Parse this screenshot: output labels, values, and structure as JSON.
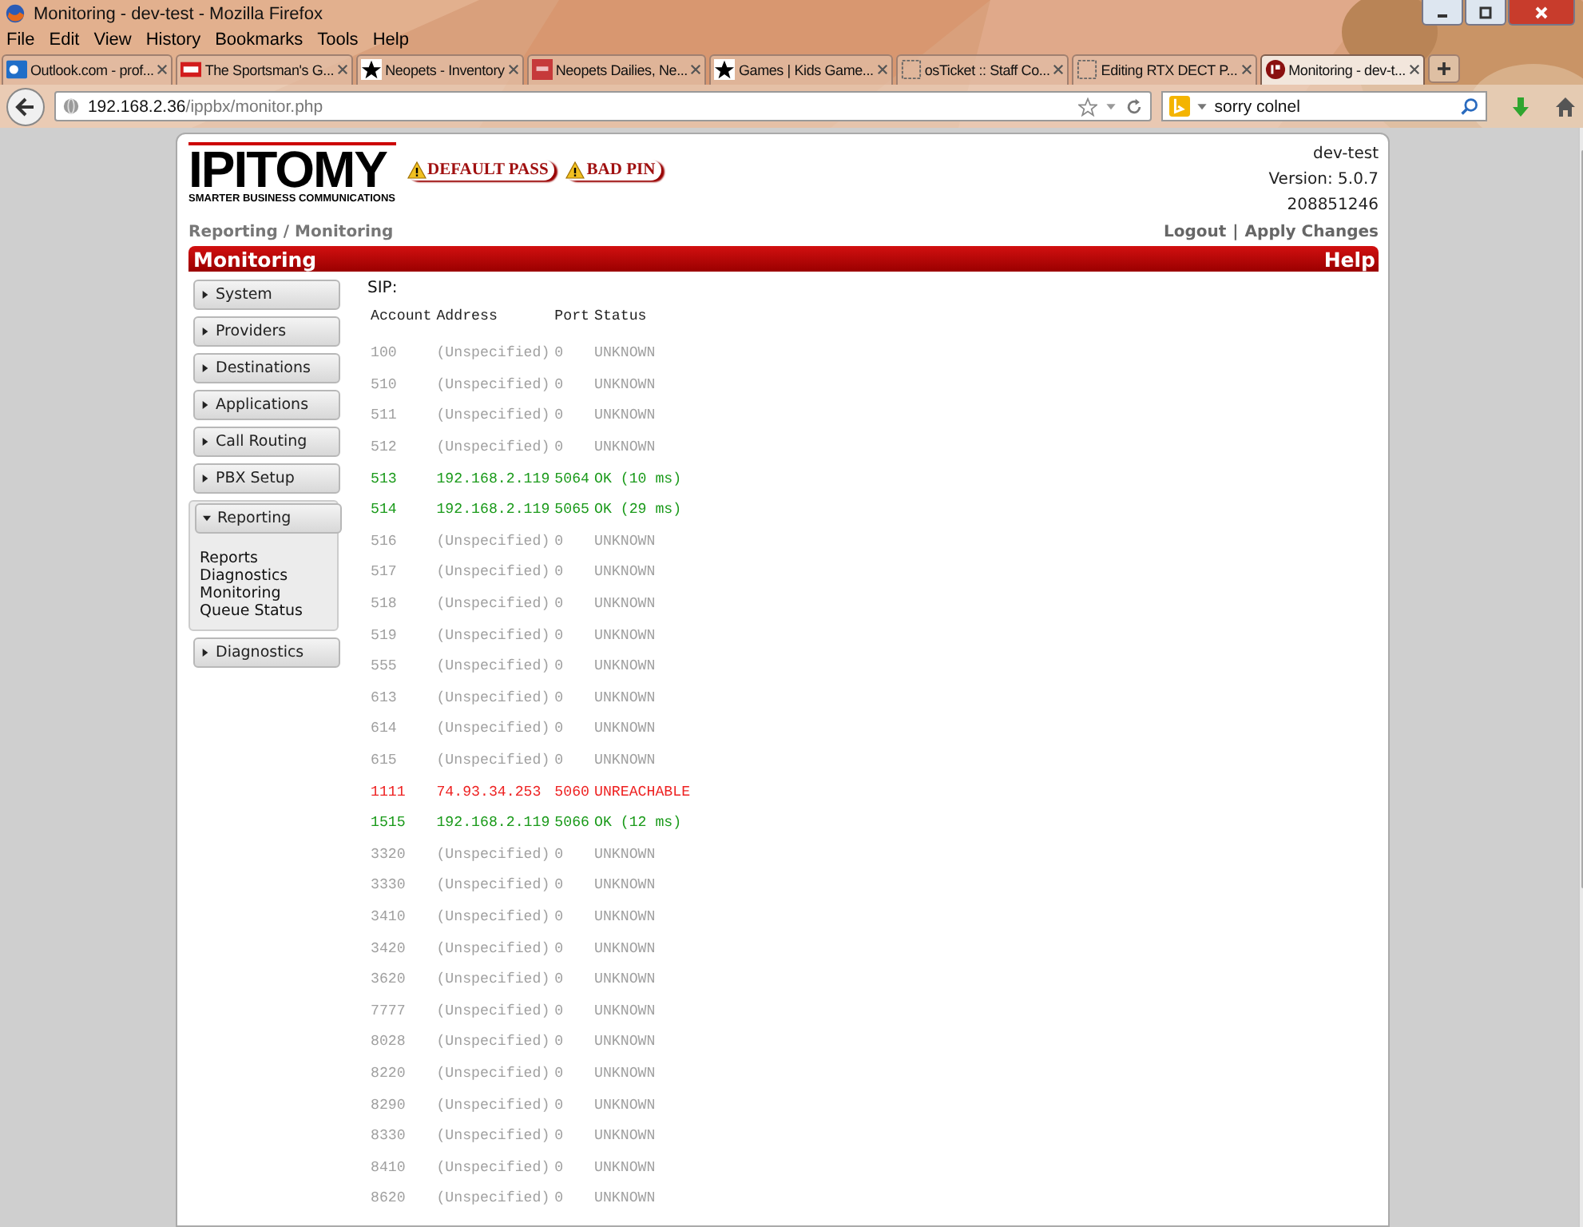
{
  "window": {
    "title": "Monitoring - dev-test - Mozilla Firefox"
  },
  "menu": [
    "File",
    "Edit",
    "View",
    "History",
    "Bookmarks",
    "Tools",
    "Help"
  ],
  "tabs": [
    {
      "label": "Outlook.com - prof...",
      "kind": "mail",
      "selected": false
    },
    {
      "label": "The Sportsman's G...",
      "kind": "store",
      "selected": false
    },
    {
      "label": "Neopets - Inventory",
      "kind": "star",
      "selected": false
    },
    {
      "label": "Neopets Dailies, Ne...",
      "kind": "badge",
      "selected": false
    },
    {
      "label": "Games | Kids Game...",
      "kind": "star",
      "selected": false
    },
    {
      "label": "osTicket :: Staff Co...",
      "kind": "page",
      "selected": false
    },
    {
      "label": "Editing RTX DECT P...",
      "kind": "page",
      "selected": false
    },
    {
      "label": "Monitoring - dev-t...",
      "kind": "logo",
      "selected": true
    }
  ],
  "address": {
    "host": "192.168.2.36",
    "path": "/ippbx/monitor.php"
  },
  "search": {
    "value": "sorry colnel"
  },
  "header": {
    "logo": "IPITOMY",
    "tagline": "SMARTER BUSINESS COMMUNICATIONS",
    "warnings": [
      "DEFAULT PASS",
      "BAD PIN"
    ],
    "hostname": "dev-test",
    "version": "Version: 5.0.7",
    "serial": "208851246",
    "breadcrumb": "Reporting / Monitoring",
    "links": [
      "Logout",
      "Apply Changes"
    ],
    "separator": "|"
  },
  "title_bar": {
    "title": "Monitoring",
    "help": "Help"
  },
  "sidebar": [
    {
      "label": "System",
      "expanded": false
    },
    {
      "label": "Providers",
      "expanded": false
    },
    {
      "label": "Destinations",
      "expanded": false
    },
    {
      "label": "Applications",
      "expanded": false
    },
    {
      "label": "Call Routing",
      "expanded": false
    },
    {
      "label": "PBX Setup",
      "expanded": false
    },
    {
      "label": "Reporting",
      "expanded": true,
      "children": [
        "Reports",
        "Diagnostics",
        "Monitoring",
        "Queue Status"
      ]
    },
    {
      "label": "Diagnostics",
      "expanded": false
    }
  ],
  "section": "SIP:",
  "table": {
    "columns": [
      "Account",
      "Address",
      "Port",
      "Status"
    ],
    "rows": [
      {
        "kind": "unknown",
        "cells": [
          "100",
          "(Unspecified)",
          "0",
          "UNKNOWN"
        ]
      },
      {
        "kind": "unknown",
        "cells": [
          "510",
          "(Unspecified)",
          "0",
          "UNKNOWN"
        ]
      },
      {
        "kind": "unknown",
        "cells": [
          "511",
          "(Unspecified)",
          "0",
          "UNKNOWN"
        ]
      },
      {
        "kind": "unknown",
        "cells": [
          "512",
          "(Unspecified)",
          "0",
          "UNKNOWN"
        ]
      },
      {
        "kind": "ok",
        "cells": [
          "513",
          "192.168.2.119",
          "5064",
          "OK (10 ms)"
        ]
      },
      {
        "kind": "ok",
        "cells": [
          "514",
          "192.168.2.119",
          "5065",
          "OK (29 ms)"
        ]
      },
      {
        "kind": "unknown",
        "cells": [
          "516",
          "(Unspecified)",
          "0",
          "UNKNOWN"
        ]
      },
      {
        "kind": "unknown",
        "cells": [
          "517",
          "(Unspecified)",
          "0",
          "UNKNOWN"
        ]
      },
      {
        "kind": "unknown",
        "cells": [
          "518",
          "(Unspecified)",
          "0",
          "UNKNOWN"
        ]
      },
      {
        "kind": "unknown",
        "cells": [
          "519",
          "(Unspecified)",
          "0",
          "UNKNOWN"
        ]
      },
      {
        "kind": "unknown",
        "cells": [
          "555",
          "(Unspecified)",
          "0",
          "UNKNOWN"
        ]
      },
      {
        "kind": "unknown",
        "cells": [
          "613",
          "(Unspecified)",
          "0",
          "UNKNOWN"
        ]
      },
      {
        "kind": "unknown",
        "cells": [
          "614",
          "(Unspecified)",
          "0",
          "UNKNOWN"
        ]
      },
      {
        "kind": "unknown",
        "cells": [
          "615",
          "(Unspecified)",
          "0",
          "UNKNOWN"
        ]
      },
      {
        "kind": "unreachable",
        "cells": [
          "1111",
          "74.93.34.253",
          "5060",
          "UNREACHABLE"
        ]
      },
      {
        "kind": "ok",
        "cells": [
          "1515",
          "192.168.2.119",
          "5066",
          "OK (12 ms)"
        ]
      },
      {
        "kind": "unknown",
        "cells": [
          "3320",
          "(Unspecified)",
          "0",
          "UNKNOWN"
        ]
      },
      {
        "kind": "unknown",
        "cells": [
          "3330",
          "(Unspecified)",
          "0",
          "UNKNOWN"
        ]
      },
      {
        "kind": "unknown",
        "cells": [
          "3410",
          "(Unspecified)",
          "0",
          "UNKNOWN"
        ]
      },
      {
        "kind": "unknown",
        "cells": [
          "3420",
          "(Unspecified)",
          "0",
          "UNKNOWN"
        ]
      },
      {
        "kind": "unknown",
        "cells": [
          "3620",
          "(Unspecified)",
          "0",
          "UNKNOWN"
        ]
      },
      {
        "kind": "unknown",
        "cells": [
          "7777",
          "(Unspecified)",
          "0",
          "UNKNOWN"
        ]
      },
      {
        "kind": "unknown",
        "cells": [
          "8028",
          "(Unspecified)",
          "0",
          "UNKNOWN"
        ]
      },
      {
        "kind": "unknown",
        "cells": [
          "8220",
          "(Unspecified)",
          "0",
          "UNKNOWN"
        ]
      },
      {
        "kind": "unknown",
        "cells": [
          "8290",
          "(Unspecified)",
          "0",
          "UNKNOWN"
        ]
      },
      {
        "kind": "unknown",
        "cells": [
          "8330",
          "(Unspecified)",
          "0",
          "UNKNOWN"
        ]
      },
      {
        "kind": "unknown",
        "cells": [
          "8410",
          "(Unspecified)",
          "0",
          "UNKNOWN"
        ]
      },
      {
        "kind": "unknown",
        "cells": [
          "8620",
          "(Unspecified)",
          "0",
          "UNKNOWN"
        ]
      }
    ]
  }
}
